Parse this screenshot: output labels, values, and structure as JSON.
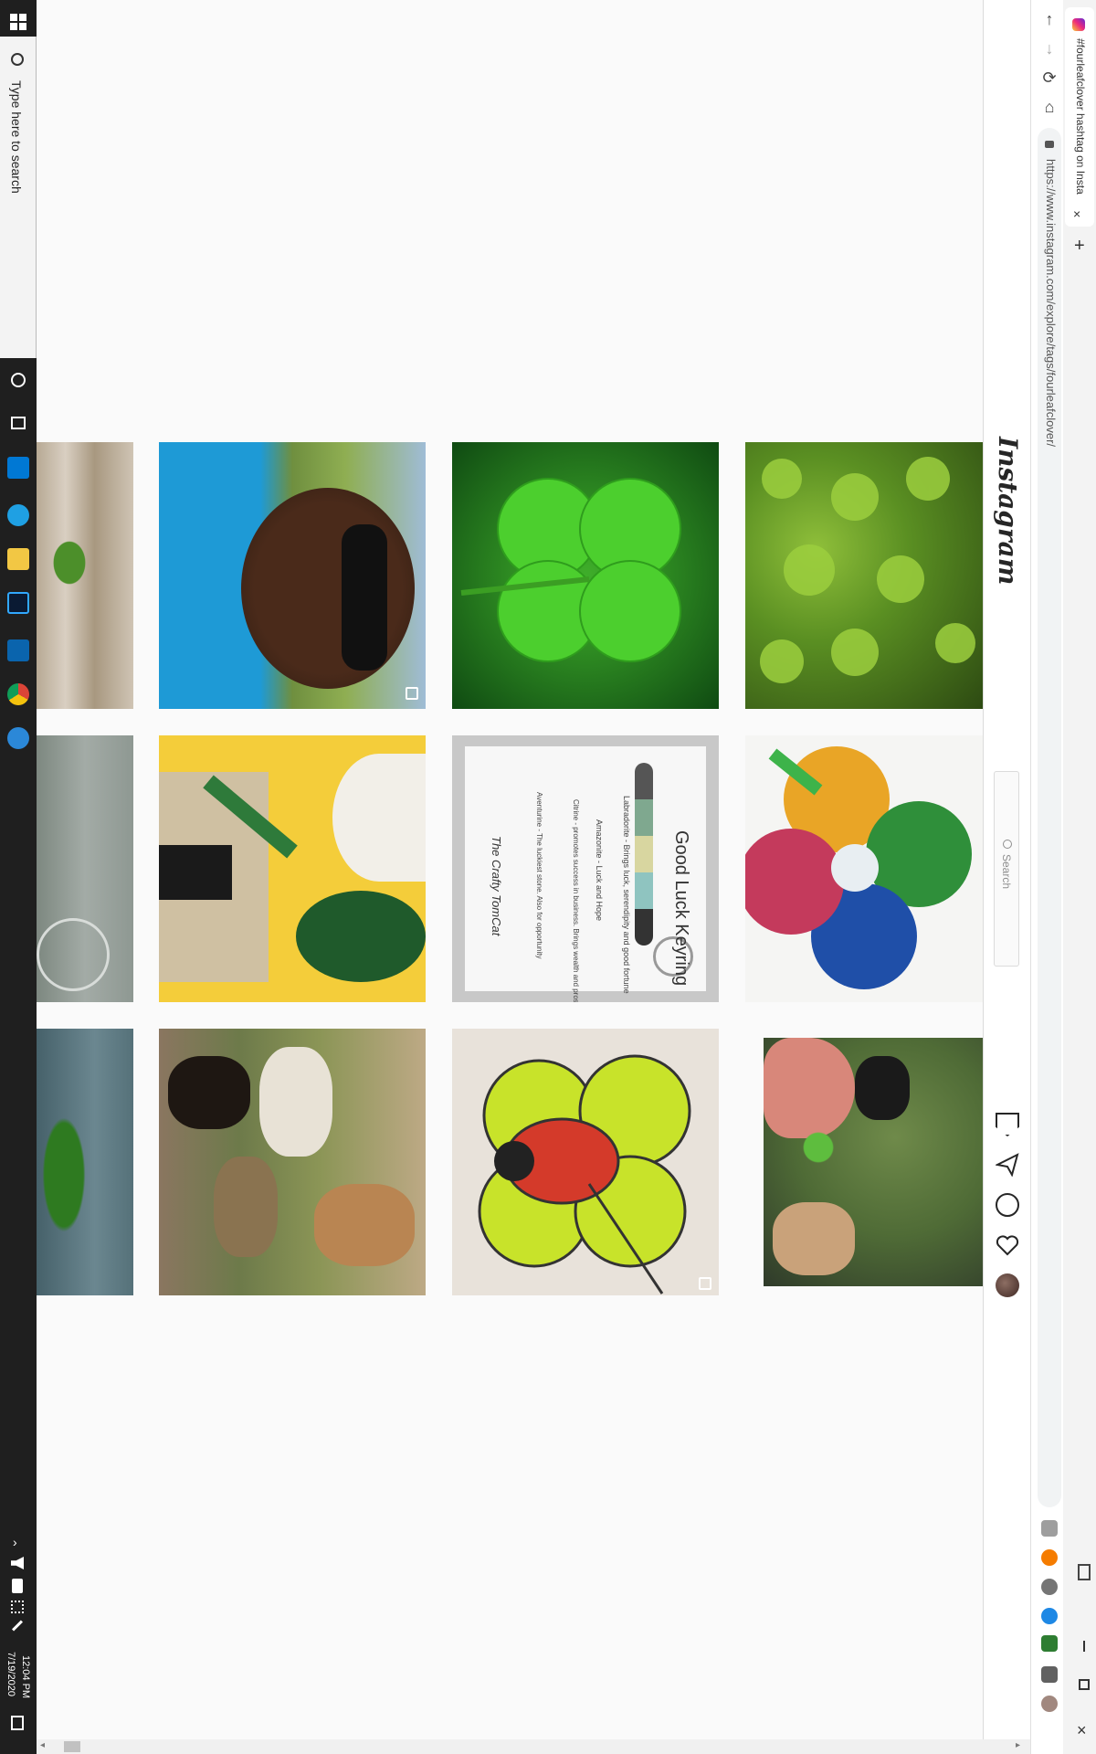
{
  "taskbar": {
    "search_placeholder": "Type here to search",
    "time": "12:04 PM",
    "date": "7/19/2020"
  },
  "browser": {
    "tab_title": "#fourleafclover hashtag on Insta",
    "url": "https://www.instagram.com/explore/tags/fourleafclover/",
    "new_tab_label": "+",
    "tab_close_label": "×"
  },
  "instagram": {
    "logo": "Instagram",
    "search_placeholder": "Search"
  },
  "posts": [
    {
      "row": 1,
      "col": 1,
      "subject": "clover on wooden boards"
    },
    {
      "row": 1,
      "col": 2,
      "subject": "smiling person selfie in field"
    },
    {
      "row": 1,
      "col": 3,
      "subject": "four leaf clover close-up"
    },
    {
      "row": 1,
      "col": 4,
      "subject": "patch of clover leaves"
    },
    {
      "row": 2,
      "col": 1,
      "subject": "glass with clover pattern"
    },
    {
      "row": 2,
      "col": 2,
      "subject": "travel flat lay on yellow"
    },
    {
      "row": 2,
      "col": 3,
      "subject": "good luck keyring card"
    },
    {
      "row": 2,
      "col": 4,
      "subject": "quilled rainbow four leaf clover"
    },
    {
      "row": 3,
      "col": 1,
      "subject": "clover leaf in water"
    },
    {
      "row": 3,
      "col": 2,
      "subject": "group of dogs on path"
    },
    {
      "row": 3,
      "col": 3,
      "subject": "stained glass clover with ladybug"
    },
    {
      "row": 3,
      "col": 4,
      "subject": "hand holding clover with dogs"
    }
  ],
  "keyring_card": {
    "title": "Good Luck Keyring",
    "lines": [
      "Labradorite - Brings luck, serendipity and good fortune",
      "Amazonite - Luck and Hope",
      "Citrine - promotes success in business. Brings wealth and prosperity",
      "Aventurine - The luckiest stone. Also for opportunity"
    ],
    "brand": "The Crafty TomCat"
  },
  "colors": {
    "accent_green": "#3fae2a",
    "instagram_text": "#262626",
    "page_bg": "#fafafa"
  }
}
